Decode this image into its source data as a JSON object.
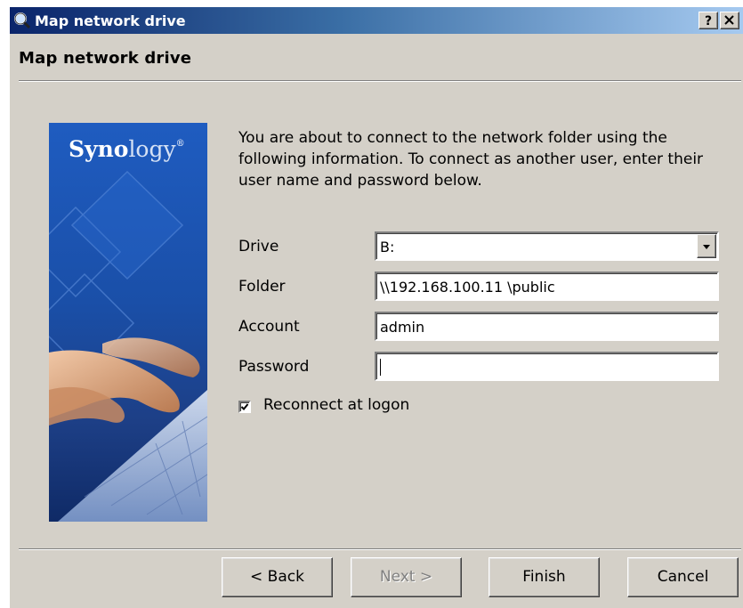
{
  "window": {
    "title": "Map network drive",
    "help_label": "?",
    "close_label": "×"
  },
  "header": {
    "title": "Map network drive"
  },
  "banner": {
    "brand_bold": "Syno",
    "brand_light": "logy",
    "trademark": "®"
  },
  "intro_text": "You are about to connect to the network folder using the following information. To connect as another user, enter their user name and password below.",
  "form": {
    "drive_label": "Drive",
    "drive_value": "B:",
    "folder_label": "Folder",
    "folder_value": "\\\\192.168.100.11 \\public",
    "account_label": "Account",
    "account_value": "admin",
    "password_label": "Password",
    "password_value": "",
    "reconnect_label": "Reconnect at logon",
    "reconnect_checked": true
  },
  "buttons": {
    "back": "< Back",
    "next": "Next >",
    "finish": "Finish",
    "cancel": "Cancel"
  },
  "colors": {
    "face": "#d4d0c8",
    "title_start": "#0a246a",
    "title_end": "#a6caf0",
    "banner_blue": "#1a4fa8"
  },
  "icons": {
    "title": "magnifier-icon",
    "dropdown": "chevron-down-icon",
    "check": "checkmark-icon"
  }
}
